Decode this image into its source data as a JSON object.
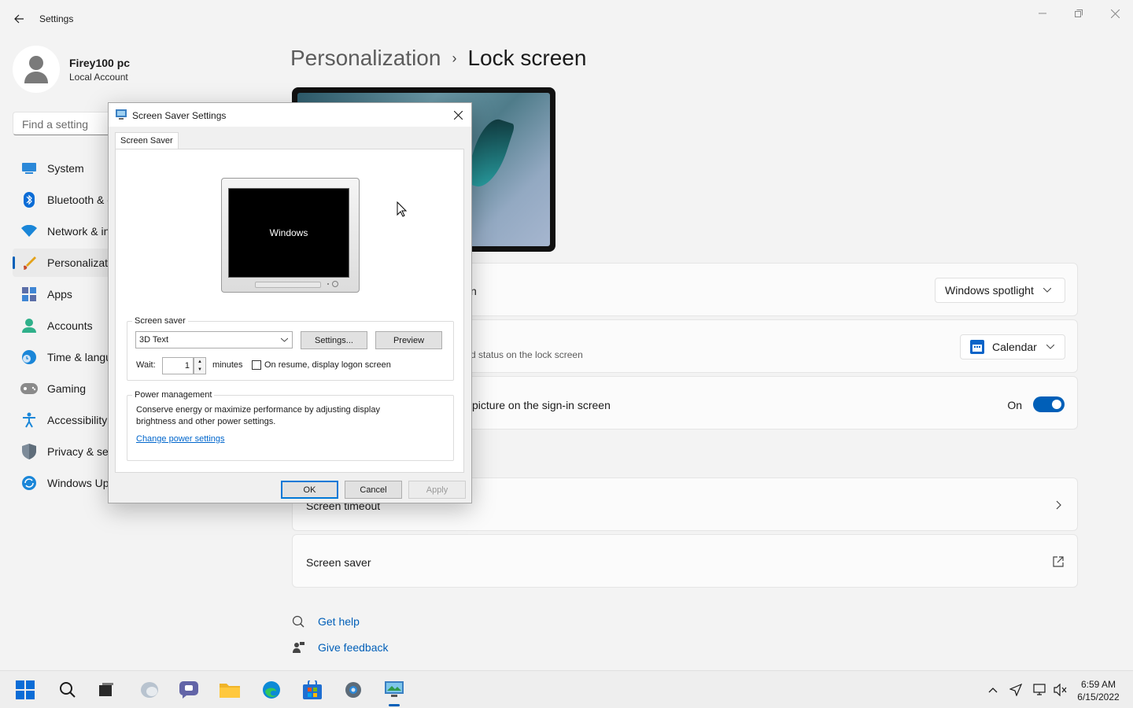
{
  "window": {
    "app_title": "Settings"
  },
  "profile": {
    "name": "Firey100 pc",
    "account": "Local Account"
  },
  "search": {
    "placeholder": "Find a setting"
  },
  "nav": {
    "items": [
      {
        "label": "System",
        "icon": "system-icon"
      },
      {
        "label": "Bluetooth & devices",
        "icon": "bluetooth-icon"
      },
      {
        "label": "Network & internet",
        "icon": "network-icon"
      },
      {
        "label": "Personalization",
        "icon": "personalization-icon",
        "active": true
      },
      {
        "label": "Apps",
        "icon": "apps-icon"
      },
      {
        "label": "Accounts",
        "icon": "accounts-icon"
      },
      {
        "label": "Time & language",
        "icon": "time-icon"
      },
      {
        "label": "Gaming",
        "icon": "gaming-icon"
      },
      {
        "label": "Accessibility",
        "icon": "accessibility-icon"
      },
      {
        "label": "Privacy & security",
        "icon": "privacy-icon"
      },
      {
        "label": "Windows Update",
        "icon": "update-icon"
      }
    ]
  },
  "breadcrumb": {
    "parent": "Personalization",
    "separator": "›",
    "current": "Lock screen"
  },
  "cards": {
    "personalize": {
      "title_visible": "n",
      "value": "Windows spotlight"
    },
    "status": {
      "sub_visible": "d status on the lock screen",
      "value": "Calendar"
    },
    "signin": {
      "title_visible": "picture on the sign-in screen",
      "toggle_label": "On"
    },
    "timeout": {
      "title": "Screen timeout"
    },
    "screensaver": {
      "title": "Screen saver"
    }
  },
  "links": {
    "help": "Get help",
    "feedback": "Give feedback"
  },
  "dialog": {
    "title": "Screen Saver Settings",
    "tab": "Screen Saver",
    "preview_text": "Windows",
    "screen_saver_group": "Screen saver",
    "selected_saver": "3D Text",
    "settings_button": "Settings...",
    "preview_button": "Preview",
    "wait_label": "Wait:",
    "wait_value": "1",
    "minutes_label": "minutes",
    "resume_label": "On resume, display logon screen",
    "power_group": "Power management",
    "power_desc": "Conserve energy or maximize performance by adjusting display brightness and other power settings.",
    "power_link": "Change power settings",
    "ok": "OK",
    "cancel": "Cancel",
    "apply": "Apply"
  },
  "taskbar": {
    "time": "6:59 AM",
    "date": "6/15/2022"
  },
  "colors": {
    "accent": "#005fb8",
    "link": "#0066cc"
  }
}
